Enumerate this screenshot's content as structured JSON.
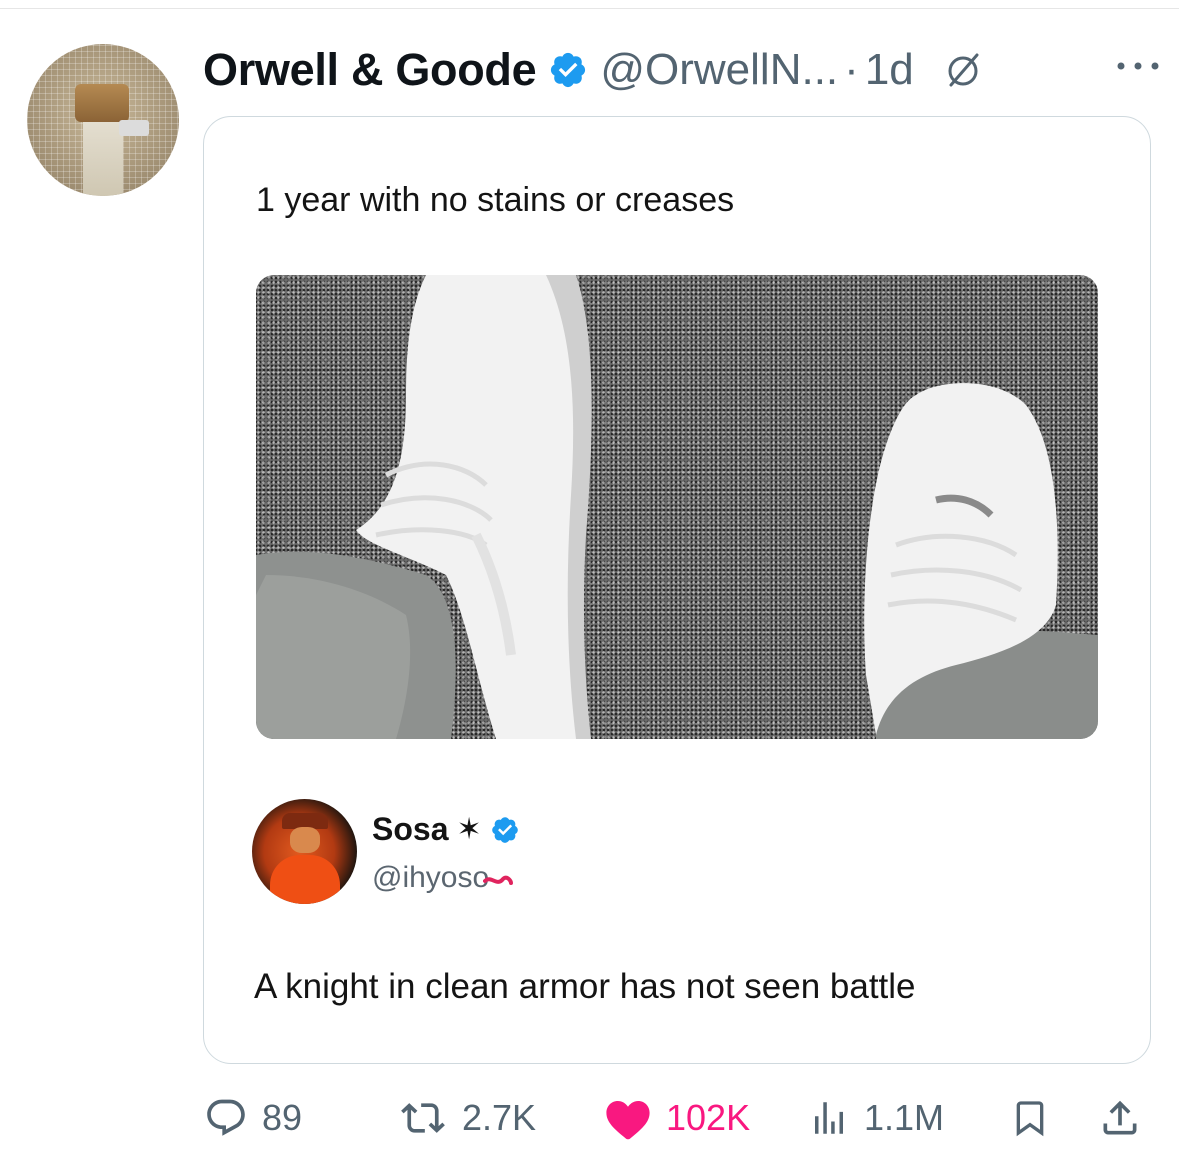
{
  "post": {
    "author_name": "Orwell & Goode",
    "handle": "@OrwellN...",
    "separator": "·",
    "time": "1d",
    "icons": {
      "verified": "verified-badge-icon",
      "grok": "grok-icon",
      "more": "more-options-icon"
    }
  },
  "embedded": {
    "caption": "1 year with no stains or creases",
    "photo_icon": "sneakers-photo",
    "quote": {
      "name": "Sosa",
      "star": "✶",
      "handle": "@ihyoso",
      "text": "A knight in clean armor has not seen battle"
    }
  },
  "actions": {
    "reply_count": "89",
    "repost_count": "2.7K",
    "like_count": "102K",
    "views_count": "1.1M",
    "icons": [
      "reply-icon",
      "repost-icon",
      "like-icon",
      "views-icon",
      "bookmark-icon",
      "share-icon"
    ]
  },
  "colors": {
    "verified_blue": "#1d9bf0",
    "like_pink": "#f91880",
    "secondary_text": "#536471"
  }
}
